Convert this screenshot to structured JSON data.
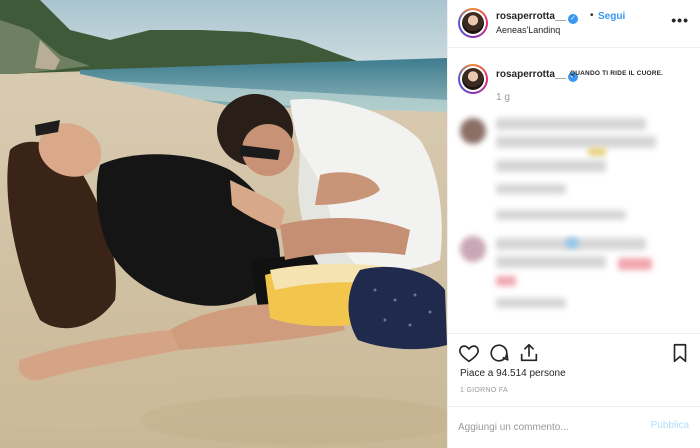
{
  "post": {
    "author": "rosaperrotta__",
    "follow_label": "Segui",
    "separator": "•",
    "location": "Aeneas'Landinq",
    "more_label": "•••",
    "caption_author": "rosaperrotta__",
    "caption_text": "QUANDO TI RIDE IL CUORE.",
    "caption_time": "1 g",
    "likes_text": "Piace a 94.514 persone",
    "time_ago": "1 GIORNO FA",
    "comment_placeholder": "Aggiungi un commento...",
    "publish_label": "Pubblica"
  },
  "icons": {
    "verified": "verified-badge-icon",
    "like": "heart-icon",
    "comment": "comment-bubble-icon",
    "share": "share-icon",
    "save": "bookmark-icon"
  },
  "colors": {
    "link_blue": "#3897f0",
    "verified": "#3897f0",
    "publish_disabled": "#b2dffc",
    "muted_text": "#999999"
  }
}
